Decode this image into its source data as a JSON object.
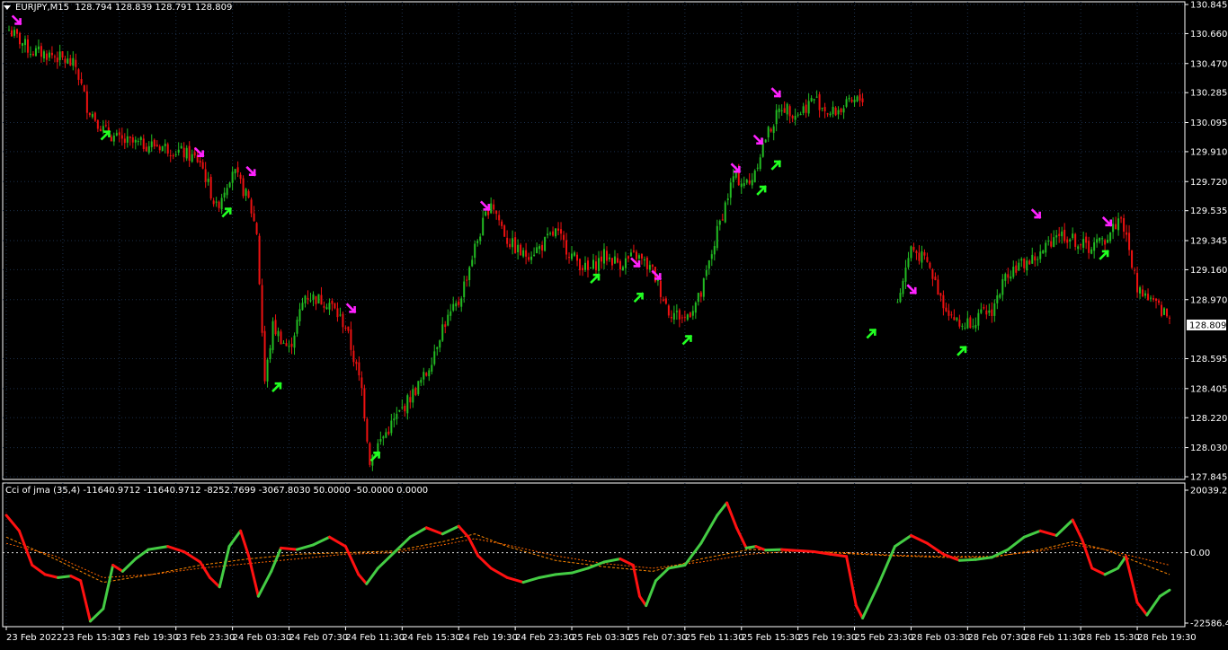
{
  "main_header": {
    "symbol": "EURJPY,M15",
    "ohlc": "128.794 128.839 128.791 128.809"
  },
  "indicator_header": {
    "text": "Cci of jma (35,4) -11640.9712 -11640.9712 -8252.7699 -3067.8030 50.0000 -50.0000 0.0000"
  },
  "colors": {
    "background": "#000000",
    "frame": "#ffffff",
    "grid": "#1c2f4a",
    "bull": "#22bb22",
    "bear": "#ee1111",
    "arrow_up": "#22ff22",
    "arrow_down": "#ff22ff",
    "cci_up": "#44cc44",
    "cci_down": "#ff1111",
    "signal_1": "#ff8800",
    "signal_2": "#ff6600",
    "zero_line": "#dddddd"
  },
  "chart_data": [
    {
      "type": "candlestick",
      "symbol": "EURJPY",
      "timeframe": "M15",
      "yticks": [
        "130.845",
        "130.660",
        "130.470",
        "130.285",
        "130.095",
        "129.910",
        "129.720",
        "129.535",
        "129.345",
        "129.160",
        "128.970",
        "128.595",
        "128.405",
        "128.220",
        "128.030",
        "127.845"
      ],
      "ylim": [
        127.845,
        130.845
      ],
      "current_price": "128.809",
      "close_path": [
        [
          0.0,
          130.7
        ],
        [
          1.5,
          130.55
        ],
        [
          3.0,
          130.52
        ],
        [
          3.8,
          130.48
        ],
        [
          4.3,
          130.45
        ],
        [
          5.0,
          130.2
        ],
        [
          6.0,
          130.05
        ],
        [
          7.0,
          129.98
        ],
        [
          8.0,
          129.96
        ],
        [
          9.5,
          129.95
        ],
        [
          11.0,
          129.9
        ],
        [
          12.0,
          129.85
        ],
        [
          13.0,
          129.55
        ],
        [
          14.0,
          129.8
        ],
        [
          15.0,
          129.6
        ],
        [
          15.5,
          129.4
        ],
        [
          16.0,
          128.45
        ],
        [
          16.5,
          128.8
        ],
        [
          17.5,
          128.65
        ],
        [
          18.5,
          129.0
        ],
        [
          20.0,
          128.95
        ],
        [
          21.0,
          128.8
        ],
        [
          22.0,
          128.4
        ],
        [
          22.5,
          127.95
        ],
        [
          23.0,
          128.05
        ],
        [
          24.0,
          128.2
        ],
        [
          25.0,
          128.35
        ],
        [
          26.0,
          128.5
        ],
        [
          27.0,
          128.8
        ],
        [
          28.0,
          128.95
        ],
        [
          29.0,
          129.3
        ],
        [
          30.0,
          129.6
        ],
        [
          31.0,
          129.35
        ],
        [
          32.0,
          129.25
        ],
        [
          33.0,
          129.3
        ],
        [
          34.0,
          129.4
        ],
        [
          35.0,
          129.25
        ],
        [
          36.0,
          129.15
        ],
        [
          37.0,
          129.25
        ],
        [
          38.0,
          129.2
        ],
        [
          39.0,
          129.25
        ],
        [
          40.0,
          129.15
        ],
        [
          41.0,
          128.9
        ],
        [
          42.0,
          128.85
        ],
        [
          43.0,
          129.0
        ],
        [
          44.0,
          129.4
        ],
        [
          45.0,
          129.75
        ],
        [
          46.0,
          129.7
        ],
        [
          47.0,
          130.0
        ],
        [
          48.0,
          130.2
        ],
        [
          49.0,
          130.15
        ],
        [
          50.0,
          130.25
        ],
        [
          51.0,
          130.15
        ],
        [
          52.0,
          130.2
        ],
        [
          53.0,
          130.25
        ]
      ],
      "gap_after": 53.0,
      "close_path_2": [
        [
          55.0,
          128.9
        ],
        [
          56.0,
          129.3
        ],
        [
          57.0,
          129.2
        ],
        [
          58.0,
          128.95
        ],
        [
          59.0,
          128.8
        ],
        [
          60.0,
          128.85
        ],
        [
          61.0,
          128.9
        ],
        [
          62.0,
          129.15
        ],
        [
          63.0,
          129.2
        ],
        [
          64.0,
          129.25
        ],
        [
          65.0,
          129.4
        ],
        [
          66.0,
          129.35
        ],
        [
          67.0,
          129.3
        ],
        [
          68.0,
          129.35
        ],
        [
          69.0,
          129.5
        ],
        [
          70.0,
          129.05
        ],
        [
          71.0,
          128.95
        ],
        [
          72.0,
          128.85
        ]
      ],
      "xlim": [
        0,
        72.5
      ],
      "xticks": [
        {
          "label": "23 Feb 2022",
          "x": 0
        },
        {
          "label": "23 Feb 15:30",
          "x": 3.5
        },
        {
          "label": "23 Feb 19:30",
          "x": 7.0
        },
        {
          "label": "23 Feb 23:30",
          "x": 10.5
        },
        {
          "label": "24 Feb 03:30",
          "x": 14.0
        },
        {
          "label": "24 Feb 07:30",
          "x": 17.5
        },
        {
          "label": "24 Feb 11:30",
          "x": 21.0
        },
        {
          "label": "24 Feb 15:30",
          "x": 24.5
        },
        {
          "label": "24 Feb 19:30",
          "x": 28.0
        },
        {
          "label": "24 Feb 23:30",
          "x": 31.5
        },
        {
          "label": "25 Feb 03:30",
          "x": 35.0
        },
        {
          "label": "25 Feb 07:30",
          "x": 38.5
        },
        {
          "label": "25 Feb 11:30",
          "x": 42.0
        },
        {
          "label": "25 Feb 15:30",
          "x": 45.5
        },
        {
          "label": "25 Feb 19:30",
          "x": 49.0
        },
        {
          "label": "25 Feb 23:30",
          "x": 52.5
        },
        {
          "label": "28 Feb 03:30",
          "x": 56.0
        },
        {
          "label": "28 Feb 07:30",
          "x": 59.5
        },
        {
          "label": "28 Feb 11:30",
          "x": 63.0
        },
        {
          "label": "28 Feb 15:30",
          "x": 66.5
        },
        {
          "label": "28 Feb 19:30",
          "x": 70.0
        }
      ],
      "arrows_up": [
        {
          "x": 6.2,
          "y": 130.02
        },
        {
          "x": 13.7,
          "y": 129.53
        },
        {
          "x": 16.8,
          "y": 128.42
        },
        {
          "x": 22.9,
          "y": 127.98
        },
        {
          "x": 36.5,
          "y": 129.11
        },
        {
          "x": 39.2,
          "y": 128.99
        },
        {
          "x": 42.2,
          "y": 128.72
        },
        {
          "x": 46.8,
          "y": 129.67
        },
        {
          "x": 47.7,
          "y": 129.83
        },
        {
          "x": 53.6,
          "y": 128.76
        },
        {
          "x": 59.2,
          "y": 128.65
        },
        {
          "x": 68.0,
          "y": 129.26
        }
      ],
      "arrows_down": [
        {
          "x": 0.7,
          "y": 130.74
        },
        {
          "x": 12.0,
          "y": 129.9
        },
        {
          "x": 15.2,
          "y": 129.78
        },
        {
          "x": 21.4,
          "y": 128.91
        },
        {
          "x": 29.7,
          "y": 129.56
        },
        {
          "x": 39.0,
          "y": 129.2
        },
        {
          "x": 40.3,
          "y": 129.12
        },
        {
          "x": 45.2,
          "y": 129.8
        },
        {
          "x": 46.6,
          "y": 129.98
        },
        {
          "x": 47.7,
          "y": 130.28
        },
        {
          "x": 56.1,
          "y": 129.03
        },
        {
          "x": 63.8,
          "y": 129.51
        },
        {
          "x": 68.2,
          "y": 129.46
        }
      ]
    },
    {
      "type": "line",
      "name": "Cci of jma (35,4)",
      "yticks": [
        "20039.218",
        "0.00",
        "-22586.416"
      ],
      "ylim": [
        -22586.416,
        20039.218
      ],
      "xlim": [
        0,
        72.5
      ],
      "cci": [
        [
          0,
          12000
        ],
        [
          0.8,
          7000
        ],
        [
          1.6,
          -4000
        ],
        [
          2.4,
          -7000
        ],
        [
          3.2,
          -8000
        ],
        [
          4.0,
          -7500
        ],
        [
          4.6,
          -9000
        ],
        [
          5.2,
          -22000
        ],
        [
          6.0,
          -18000
        ],
        [
          6.6,
          -4000
        ],
        [
          7.2,
          -6000
        ],
        [
          8.0,
          -2000
        ],
        [
          8.8,
          1000
        ],
        [
          10.0,
          2000
        ],
        [
          11.0,
          300
        ],
        [
          12.0,
          -3000
        ],
        [
          12.6,
          -8000
        ],
        [
          13.2,
          -11000
        ],
        [
          13.8,
          2000
        ],
        [
          14.5,
          7000
        ],
        [
          15.0,
          -1000
        ],
        [
          15.6,
          -14000
        ],
        [
          16.4,
          -6000
        ],
        [
          17.0,
          1500
        ],
        [
          18.0,
          1000
        ],
        [
          19.0,
          2500
        ],
        [
          20.0,
          5000
        ],
        [
          21.0,
          2000
        ],
        [
          21.8,
          -7000
        ],
        [
          22.3,
          -10000
        ],
        [
          23.0,
          -5000
        ],
        [
          24.0,
          0
        ],
        [
          25.0,
          5000
        ],
        [
          26.0,
          8000
        ],
        [
          27.0,
          6000
        ],
        [
          28.0,
          8500
        ],
        [
          28.6,
          5000
        ],
        [
          29.2,
          -1000
        ],
        [
          30.0,
          -5000
        ],
        [
          31.0,
          -8000
        ],
        [
          32.0,
          -9500
        ],
        [
          33.0,
          -8000
        ],
        [
          34.0,
          -7000
        ],
        [
          35.0,
          -6500
        ],
        [
          36.0,
          -5000
        ],
        [
          37.0,
          -3000
        ],
        [
          38.0,
          -2000
        ],
        [
          38.8,
          -4000
        ],
        [
          39.2,
          -14000
        ],
        [
          39.6,
          -17000
        ],
        [
          40.2,
          -9000
        ],
        [
          41.0,
          -5000
        ],
        [
          42.0,
          -4000
        ],
        [
          43.0,
          3000
        ],
        [
          44.0,
          12000
        ],
        [
          44.6,
          16000
        ],
        [
          45.2,
          8000
        ],
        [
          45.8,
          1500
        ],
        [
          46.4,
          2000
        ],
        [
          47.0,
          800
        ],
        [
          48.0,
          1000
        ],
        [
          50.0,
          300
        ],
        [
          51.0,
          -500
        ],
        [
          52.0,
          -1200
        ],
        [
          52.6,
          -17000
        ],
        [
          53.0,
          -21000
        ],
        [
          54.0,
          -10000
        ],
        [
          55.0,
          2000
        ],
        [
          56.0,
          5500
        ],
        [
          57.0,
          3000
        ],
        [
          58.0,
          -500
        ],
        [
          59.0,
          -2500
        ],
        [
          60.0,
          -2200
        ],
        [
          61.0,
          -1500
        ],
        [
          62.0,
          1000
        ],
        [
          63.0,
          5000
        ],
        [
          64.0,
          7000
        ],
        [
          65.0,
          5500
        ],
        [
          66.0,
          10500
        ],
        [
          66.6,
          4000
        ],
        [
          67.2,
          -5000
        ],
        [
          68.0,
          -7000
        ],
        [
          68.8,
          -5000
        ],
        [
          69.3,
          -1200
        ],
        [
          70.0,
          -16000
        ],
        [
          70.6,
          -20000
        ],
        [
          71.4,
          -14000
        ],
        [
          72.0,
          -12000
        ]
      ],
      "signal_1": [
        [
          0,
          5000
        ],
        [
          3,
          -2000
        ],
        [
          6,
          -9500
        ],
        [
          9,
          -7000
        ],
        [
          12,
          -4000
        ],
        [
          15,
          -2000
        ],
        [
          18,
          -500
        ],
        [
          21,
          0
        ],
        [
          24,
          500
        ],
        [
          27,
          3500
        ],
        [
          29,
          6000
        ],
        [
          31,
          2000
        ],
        [
          34,
          -2500
        ],
        [
          37,
          -4500
        ],
        [
          40,
          -6000
        ],
        [
          43,
          -2000
        ],
        [
          46,
          1000
        ],
        [
          49,
          800
        ],
        [
          52,
          -300
        ],
        [
          55,
          -1000
        ],
        [
          58,
          -1500
        ],
        [
          61,
          -1500
        ],
        [
          64,
          1000
        ],
        [
          66,
          3500
        ],
        [
          68,
          1000
        ],
        [
          70,
          -3000
        ],
        [
          72,
          -7000
        ]
      ],
      "signal_2": [
        [
          0,
          3000
        ],
        [
          3,
          -1000
        ],
        [
          6,
          -8000
        ],
        [
          9,
          -7000
        ],
        [
          12,
          -5000
        ],
        [
          15,
          -3500
        ],
        [
          18,
          -2000
        ],
        [
          21,
          -500
        ],
        [
          24,
          0
        ],
        [
          27,
          2500
        ],
        [
          29,
          4500
        ],
        [
          31,
          2500
        ],
        [
          34,
          -1000
        ],
        [
          37,
          -3500
        ],
        [
          40,
          -5000
        ],
        [
          43,
          -3000
        ],
        [
          46,
          -500
        ],
        [
          49,
          500
        ],
        [
          52,
          0
        ],
        [
          55,
          -800
        ],
        [
          58,
          -1200
        ],
        [
          61,
          -1200
        ],
        [
          64,
          500
        ],
        [
          66,
          2500
        ],
        [
          68,
          1000
        ],
        [
          70,
          -1500
        ],
        [
          72,
          -4000
        ]
      ],
      "levels": [
        0
      ]
    }
  ]
}
